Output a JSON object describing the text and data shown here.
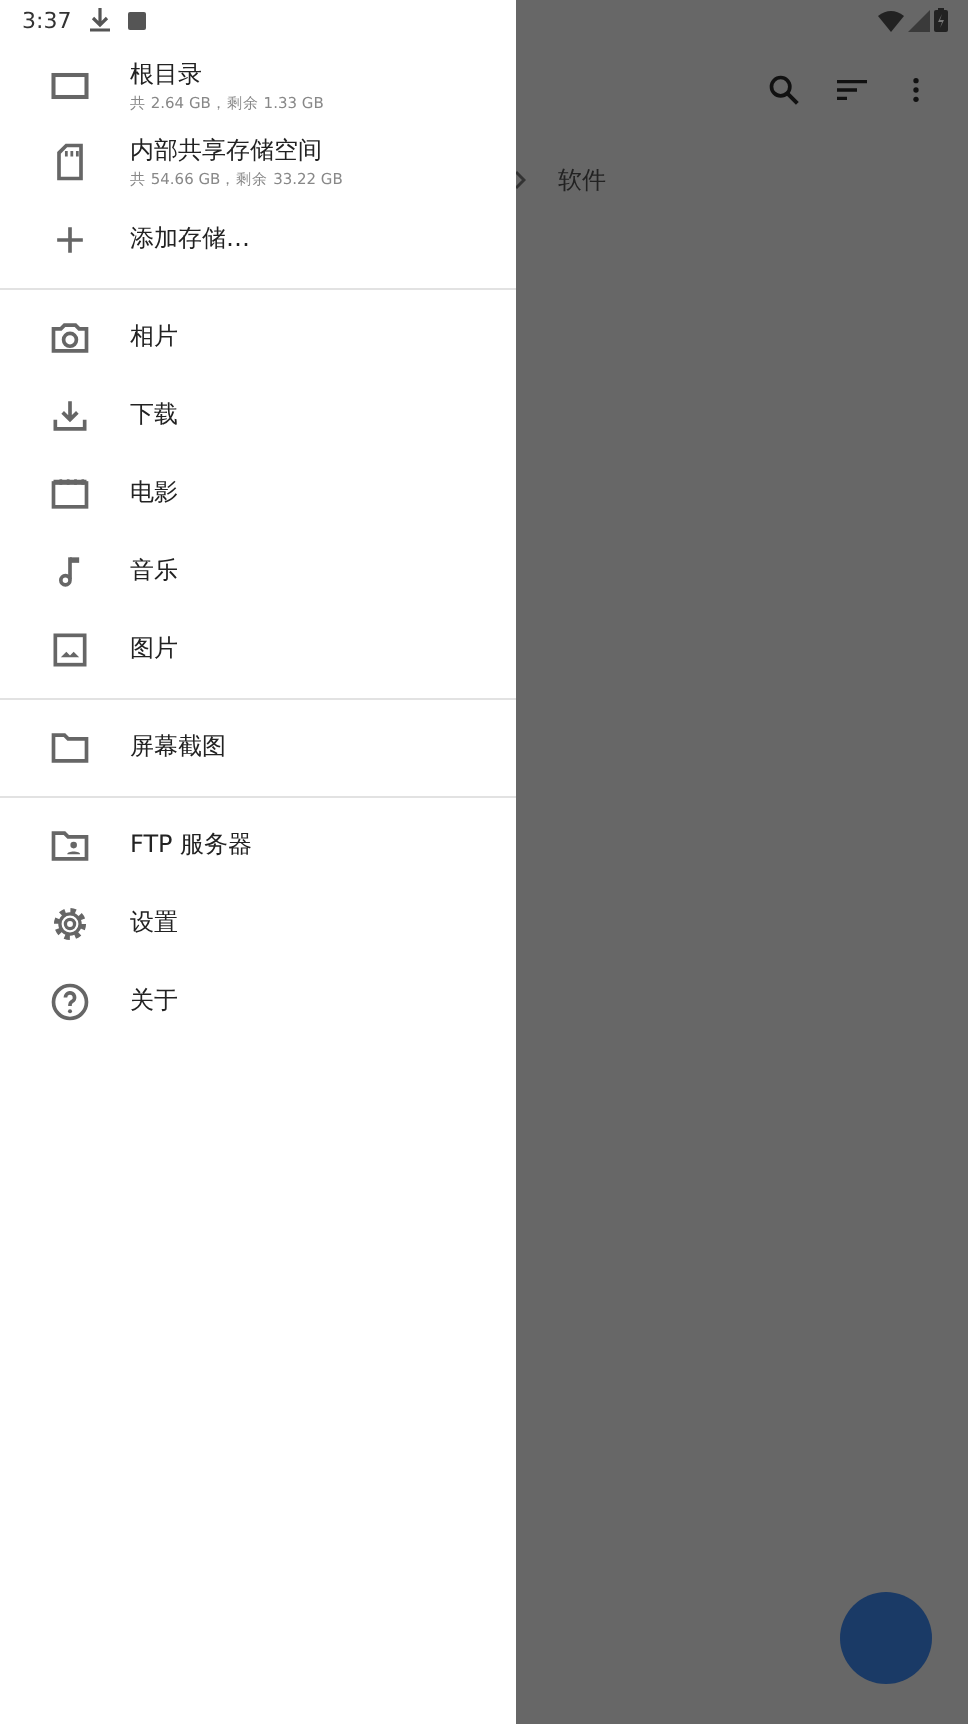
{
  "status_bar": {
    "time": "3:37"
  },
  "drawer": {
    "sections": [
      {
        "items": [
          {
            "kind": "storage",
            "label": "根目录",
            "detail": "共 2.64 GB，剩余 1.33 GB"
          },
          {
            "kind": "storage",
            "label": "内部共享存储空间",
            "detail": "共 54.66 GB，剩余 33.22 GB"
          },
          {
            "kind": "plain",
            "label": "添加存储…"
          }
        ]
      },
      {
        "items": [
          {
            "kind": "plain",
            "label": "相片"
          },
          {
            "kind": "plain",
            "label": "下载"
          },
          {
            "kind": "plain",
            "label": "电影"
          },
          {
            "kind": "plain",
            "label": "音乐"
          },
          {
            "kind": "plain",
            "label": "图片"
          }
        ]
      },
      {
        "items": [
          {
            "kind": "plain",
            "label": "屏幕截图"
          }
        ]
      },
      {
        "items": [
          {
            "kind": "plain",
            "label": "FTP 服务器"
          },
          {
            "kind": "plain",
            "label": "设置"
          },
          {
            "kind": "plain",
            "label": "关于"
          }
        ]
      }
    ]
  },
  "content": {
    "breadcrumb": "软件"
  }
}
